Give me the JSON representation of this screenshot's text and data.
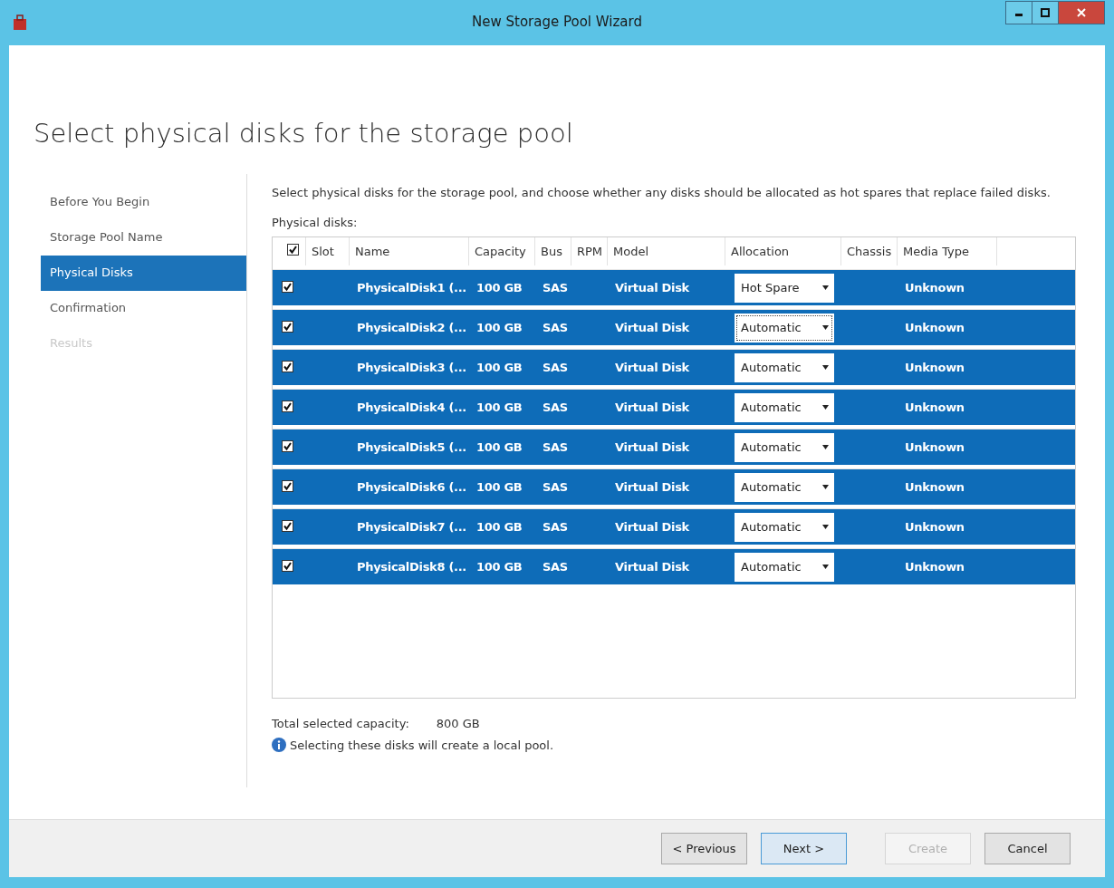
{
  "window": {
    "title": "New Storage Pool Wizard"
  },
  "heading": "Select physical disks for the storage pool",
  "steps": [
    {
      "label": "Before You Begin",
      "selected": false,
      "disabled": false
    },
    {
      "label": "Storage Pool Name",
      "selected": false,
      "disabled": false
    },
    {
      "label": "Physical Disks",
      "selected": true,
      "disabled": false
    },
    {
      "label": "Confirmation",
      "selected": false,
      "disabled": false
    },
    {
      "label": "Results",
      "selected": false,
      "disabled": true
    }
  ],
  "description": "Select physical disks for the storage pool, and choose whether any disks should be allocated as hot spares that replace failed disks.",
  "disks_label": "Physical disks:",
  "table": {
    "header_checked": true,
    "columns": [
      "Slot",
      "Name",
      "Capacity",
      "Bus",
      "RPM",
      "Model",
      "Allocation",
      "Chassis",
      "Media Type"
    ],
    "rows": [
      {
        "checked": true,
        "selected": true,
        "name": "PhysicalDisk1 (...",
        "capacity": "100 GB",
        "bus": "SAS",
        "model": "Virtual Disk",
        "allocation": "Hot Spare",
        "focused": false,
        "media_type": "Unknown"
      },
      {
        "checked": true,
        "selected": true,
        "name": "PhysicalDisk2 (...",
        "capacity": "100 GB",
        "bus": "SAS",
        "model": "Virtual Disk",
        "allocation": "Automatic",
        "focused": true,
        "media_type": "Unknown"
      },
      {
        "checked": true,
        "selected": true,
        "name": "PhysicalDisk3 (...",
        "capacity": "100 GB",
        "bus": "SAS",
        "model": "Virtual Disk",
        "allocation": "Automatic",
        "focused": false,
        "media_type": "Unknown"
      },
      {
        "checked": true,
        "selected": true,
        "name": "PhysicalDisk4 (...",
        "capacity": "100 GB",
        "bus": "SAS",
        "model": "Virtual Disk",
        "allocation": "Automatic",
        "focused": false,
        "media_type": "Unknown"
      },
      {
        "checked": true,
        "selected": true,
        "name": "PhysicalDisk5 (...",
        "capacity": "100 GB",
        "bus": "SAS",
        "model": "Virtual Disk",
        "allocation": "Automatic",
        "focused": false,
        "media_type": "Unknown"
      },
      {
        "checked": true,
        "selected": true,
        "name": "PhysicalDisk6 (...",
        "capacity": "100 GB",
        "bus": "SAS",
        "model": "Virtual Disk",
        "allocation": "Automatic",
        "focused": false,
        "media_type": "Unknown"
      },
      {
        "checked": true,
        "selected": true,
        "name": "PhysicalDisk7 (...",
        "capacity": "100 GB",
        "bus": "SAS",
        "model": "Virtual Disk",
        "allocation": "Automatic",
        "focused": false,
        "media_type": "Unknown"
      },
      {
        "checked": true,
        "selected": true,
        "name": "PhysicalDisk8 (...",
        "capacity": "100 GB",
        "bus": "SAS",
        "model": "Virtual Disk",
        "allocation": "Automatic",
        "focused": false,
        "media_type": "Unknown"
      }
    ]
  },
  "total_label": "Total selected capacity:",
  "total_value": "800 GB",
  "info": "Selecting these disks will create a local pool.",
  "buttons": [
    {
      "label": "< Previous",
      "disabled": false,
      "default": false
    },
    {
      "label": "Next >",
      "disabled": false,
      "default": true
    },
    {
      "label": "Create",
      "disabled": true,
      "default": false
    },
    {
      "label": "Cancel",
      "disabled": false,
      "default": false
    }
  ]
}
